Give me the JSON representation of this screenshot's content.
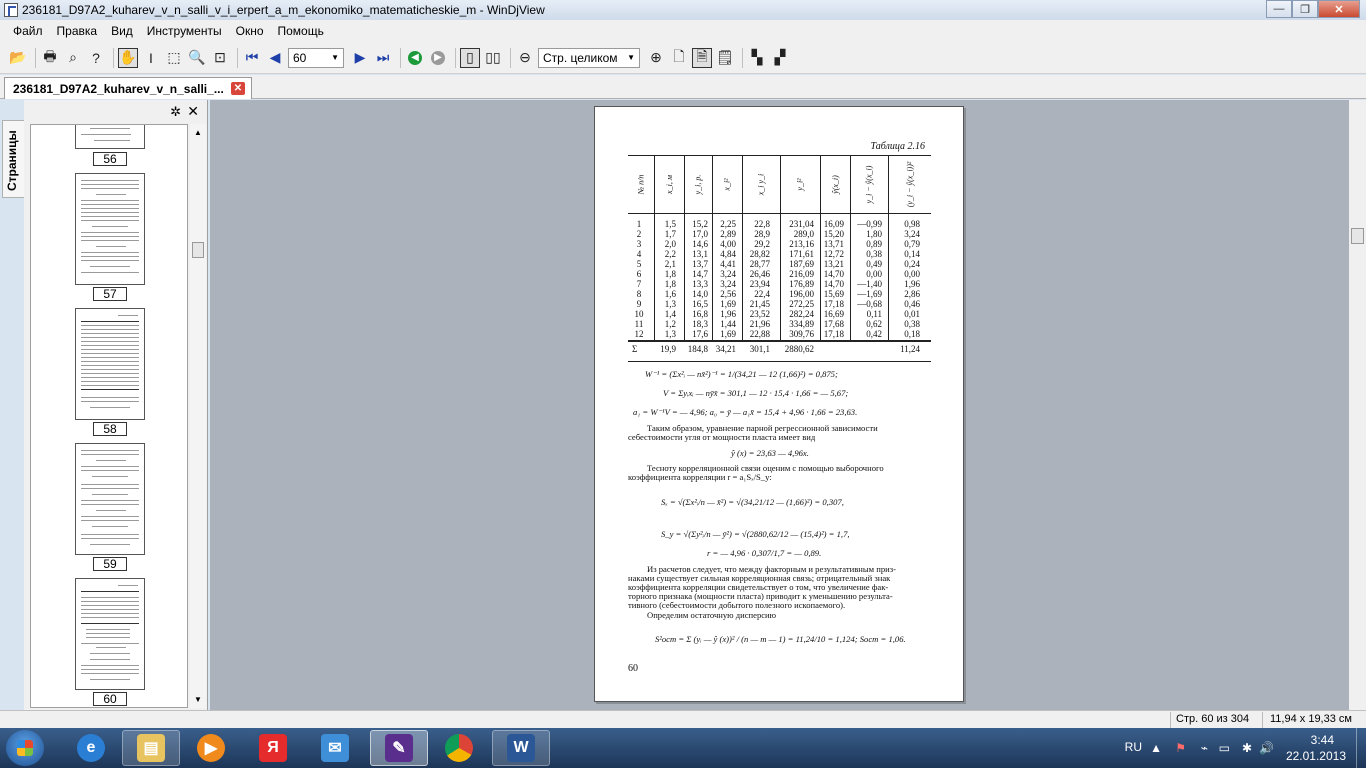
{
  "window": {
    "title": "236181_D97A2_kuharev_v_n_salli_v_i_erpert_a_m_ekonomiko_matematicheskie_m - WinDjView",
    "minimize": "—",
    "maximize": "❐",
    "close": "✕"
  },
  "menu": [
    "Файл",
    "Правка",
    "Вид",
    "Инструменты",
    "Окно",
    "Помощь"
  ],
  "toolbar": {
    "page_value": "60",
    "zoom_value": "Стр. целиком"
  },
  "tab": {
    "label": "236181_D97A2_kuharev_v_n_salli_...",
    "close": "✕"
  },
  "sidebar": {
    "vertical_tab_label": "Страницы",
    "page_numbers": [
      "56",
      "57",
      "58",
      "59",
      "60"
    ]
  },
  "doc_page": {
    "caption": "Таблица 2.16",
    "headers": [
      "№ п/п",
      "x_i, м",
      "y_i, р.",
      "x_i²",
      "x_i y_i",
      "y_i²",
      "ŷ(x_i)",
      "y_i − ŷ(x_i)",
      "(y_i − ŷ(x_i))²"
    ],
    "rows": [
      [
        "1",
        "1,5",
        "15,2",
        "2,25",
        "22,8",
        "231,04",
        "16,09",
        "—0,99",
        "0,98"
      ],
      [
        "2",
        "1,7",
        "17,0",
        "2,89",
        "28,9",
        "289,0",
        "15,20",
        "1,80",
        "3,24"
      ],
      [
        "3",
        "2,0",
        "14,6",
        "4,00",
        "29,2",
        "213,16",
        "13,71",
        "0,89",
        "0,79"
      ],
      [
        "4",
        "2,2",
        "13,1",
        "4,84",
        "28,82",
        "171,61",
        "12,72",
        "0,38",
        "0,14"
      ],
      [
        "5",
        "2,1",
        "13,7",
        "4,41",
        "28,77",
        "187,69",
        "13,21",
        "0,49",
        "0,24"
      ],
      [
        "6",
        "1,8",
        "14,7",
        "3,24",
        "26,46",
        "216,09",
        "14,70",
        "0,00",
        "0,00"
      ],
      [
        "7",
        "1,8",
        "13,3",
        "3,24",
        "23,94",
        "176,89",
        "14,70",
        "—1,40",
        "1,96"
      ],
      [
        "8",
        "1,6",
        "14,0",
        "2,56",
        "22,4",
        "196,00",
        "15,69",
        "—1,69",
        "2,86"
      ],
      [
        "9",
        "1,3",
        "16,5",
        "1,69",
        "21,45",
        "272,25",
        "17,18",
        "—0,68",
        "0,46"
      ],
      [
        "10",
        "1,4",
        "16,8",
        "1,96",
        "23,52",
        "282,24",
        "16,69",
        "0,11",
        "0,01"
      ],
      [
        "11",
        "1,2",
        "18,3",
        "1,44",
        "21,96",
        "334,89",
        "17,68",
        "0,62",
        "0,38"
      ],
      [
        "12",
        "1,3",
        "17,6",
        "1,69",
        "22,88",
        "309,76",
        "17,18",
        "0,42",
        "0,18"
      ]
    ],
    "sum_row": [
      "Σ",
      "19,9",
      "184,8",
      "34,21",
      "301,1",
      "2880,62",
      "",
      "",
      "11,24"
    ],
    "formula1": "W⁻¹ = (Σx²ᵢ — nx̄²)⁻¹ = 1/(34,21 — 12 (1,66)²) = 0,875;",
    "formula2": "V = Σyᵢxᵢ — nȳx̄ = 301,1 — 12 · 15,4 · 1,66 = — 5,67;",
    "formula3": "a₁ = W⁻¹V = — 4,96;   a₀ = ȳ — a₁x̄ = 15,4 + 4,96 · 1,66 = 23,63.",
    "para1_l1": "Таким образом, уравнение парной регрессионной зависимости",
    "para1_l2": "себестоимости угля от мощности пласта имеет вид",
    "formula4": "ŷ (x) = 23,63 — 4,96x.",
    "para2_l1": "Тесноту корреляционной связи оценим с помощью выборочного",
    "para2_l2": "коэффициента корреляции  r = a₁Sₓ/S_y:",
    "formula5": "Sₓ = √(Σx²ᵢ/n — x̄²) = √(34,21/12 — (1,66)²) = 0,307,",
    "formula6": "S_y = √(Σy²ᵢ/n — ȳ²) = √(2880,62/12 — (15,4)²) = 1,7,",
    "formula7": "r = — 4,96 · 0,307/1,7 = — 0,89.",
    "para3_l1": "Из расчетов следует, что между факторным и результативным приз-",
    "para3_l2": "наками существует сильная корреляционная связь; отрицательный знак",
    "para3_l3": "коэффициента корреляции свидетельствует о том, что увеличение фак-",
    "para3_l4": "торного признака (мощности пласта) приводит к уменьшению результа-",
    "para3_l5": "тивного (себестоимости добытого полезного ископаемого).",
    "para4": "Определим остаточную дисперсию",
    "formula8": "S²ост = Σ (yᵢ — ŷ (x))² / (n — m — 1) = 11,24/10 = 1,124;   Sост = 1,06.",
    "page_number": "60"
  },
  "status": {
    "page_info": "Стр. 60 из 304",
    "size_info": "11,94 x 19,33 см"
  },
  "taskbar": {
    "lang": "RU",
    "time": "3:44",
    "date": "22.01.2013"
  }
}
